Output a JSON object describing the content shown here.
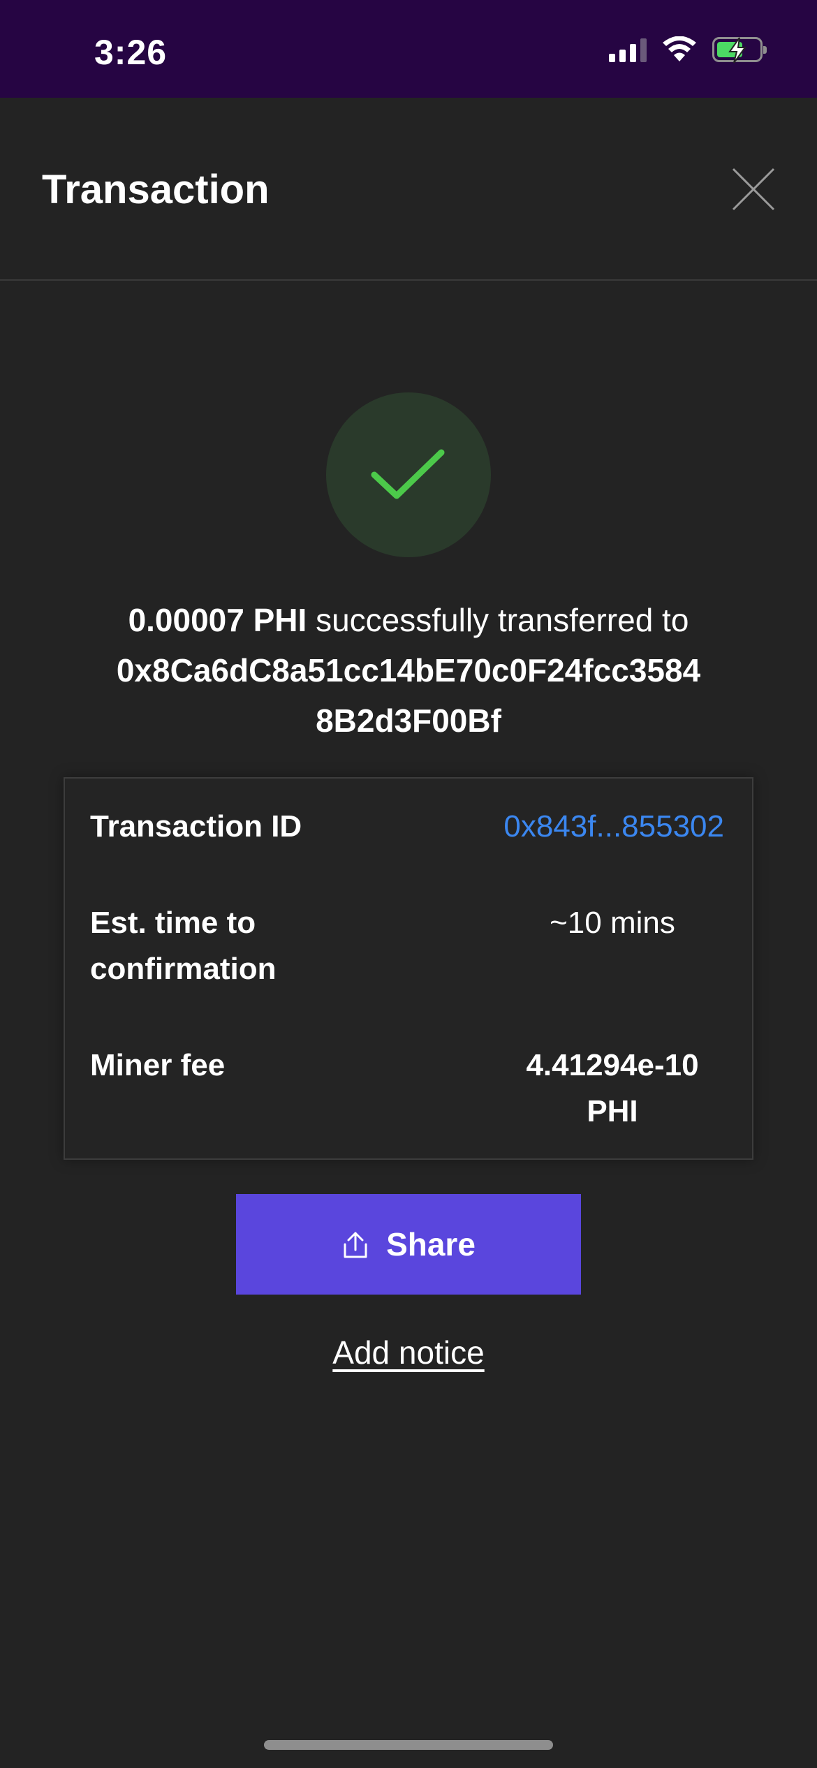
{
  "status_bar": {
    "time": "3:26",
    "icons": [
      "cellular-signal-icon",
      "wifi-icon",
      "battery-charging-icon"
    ]
  },
  "header": {
    "title": "Transaction",
    "close_icon": "close-icon"
  },
  "success": {
    "icon": "checkmark-icon",
    "amount": "0.00007 PHI",
    "message_text": " successfully transferred to",
    "recipient_line1": "0x8Ca6dC8a51cc14bE70c0F24fcc3584",
    "recipient_line2": "8B2d3F00Bf"
  },
  "details": {
    "transaction_id_label": "Transaction ID",
    "transaction_id_value": "0x843f...855302",
    "est_time_label": "Est. time to confirmation",
    "est_time_value": "~10 mins",
    "miner_fee_label": "Miner fee",
    "miner_fee_value": "4.41294e-10 PHI"
  },
  "actions": {
    "share_label": "Share",
    "share_icon": "share-icon",
    "add_notice_label": "Add notice"
  },
  "colors": {
    "status_bar_bg": "#260543",
    "background": "#232323",
    "accent": "#5a46dd",
    "link": "#3b87f0",
    "success": "#4cc94a",
    "success_circle": "#2a3a2b"
  }
}
